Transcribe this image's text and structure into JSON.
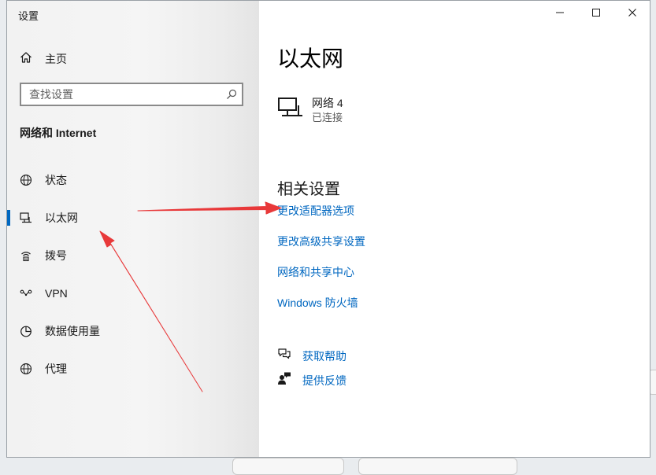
{
  "window": {
    "title": "设置"
  },
  "sidebar": {
    "home_label": "主页",
    "search_placeholder": "查找设置",
    "section_title": "网络和 Internet",
    "items": [
      {
        "label": "状态",
        "icon": "globe-status-icon",
        "active": false
      },
      {
        "label": "以太网",
        "icon": "ethernet-icon",
        "active": true
      },
      {
        "label": "拨号",
        "icon": "dial-up-icon",
        "active": false
      },
      {
        "label": "VPN",
        "icon": "vpn-icon",
        "active": false
      },
      {
        "label": "数据使用量",
        "icon": "data-usage-icon",
        "active": false
      },
      {
        "label": "代理",
        "icon": "globe-proxy-icon",
        "active": false
      }
    ]
  },
  "main": {
    "title": "以太网",
    "adapter": {
      "name": "网络 4",
      "status": "已连接",
      "icon": "computer-network-icon"
    },
    "related_title": "相关设置",
    "links": [
      "更改适配器选项",
      "更改高级共享设置",
      "网络和共享中心",
      "Windows 防火墙"
    ],
    "help": {
      "get_help": "获取帮助",
      "feedback": "提供反馈"
    }
  },
  "window_controls": [
    "minimize-icon",
    "maximize-icon",
    "close-icon"
  ],
  "colors": {
    "accent": "#0067c0",
    "arrow": "#e8393a",
    "sidebar_bg": "#f2f2f2",
    "text": "#1a1a1a"
  }
}
